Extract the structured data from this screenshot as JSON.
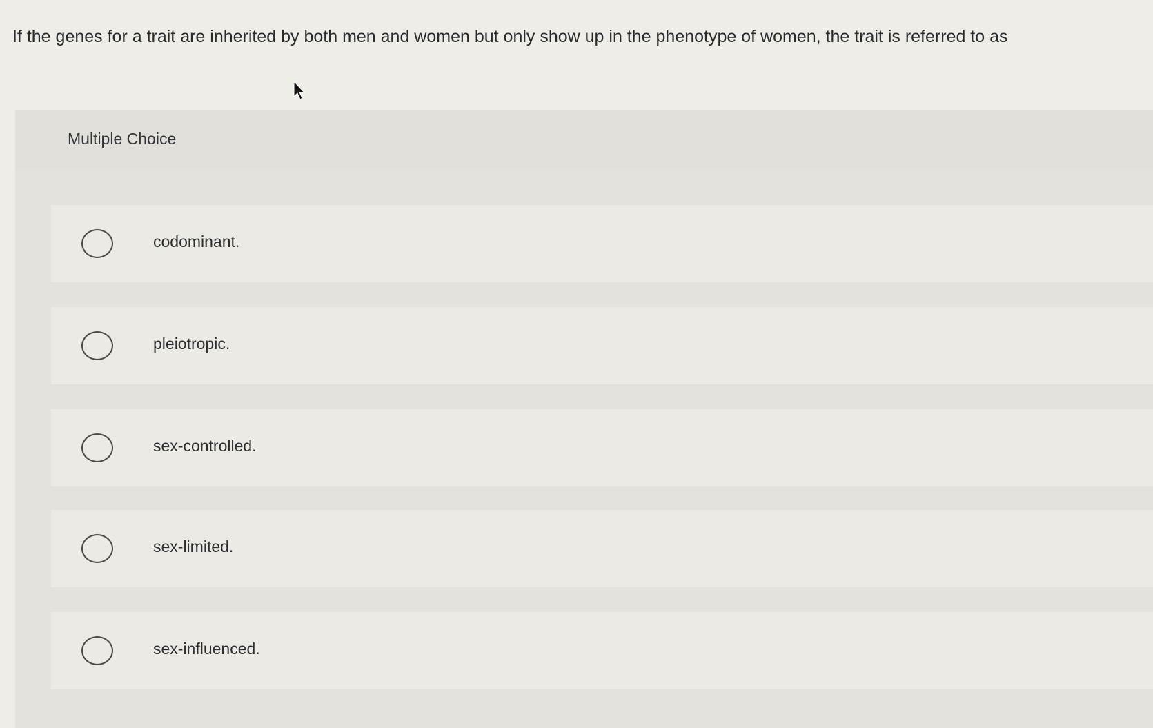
{
  "question": {
    "text": "If the genes for a trait are inherited by both men and women but only show up in the phenotype of women, the trait is referred to as"
  },
  "panel": {
    "title": "Multiple Choice"
  },
  "options": [
    {
      "label": "codominant."
    },
    {
      "label": "pleiotropic."
    },
    {
      "label": "sex-controlled."
    },
    {
      "label": "sex-limited."
    },
    {
      "label": "sex-influenced."
    }
  ]
}
